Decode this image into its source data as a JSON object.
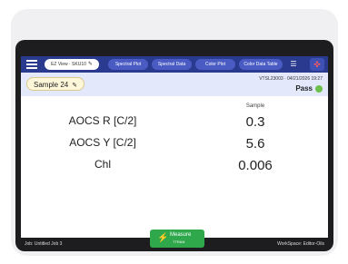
{
  "tabs": {
    "ez_view": "EZ View · SKU10",
    "spectral_plot": "Spectral Plot",
    "spectral_data": "Spectral Data",
    "color_plot": "Color Plot",
    "color_data_table": "Color Data Table"
  },
  "header": {
    "sample_label": "Sample 24",
    "status_line": "VTSL23003 · 04/21/2026 19:27",
    "pass_label": "Pass"
  },
  "table": {
    "column_header": "Sample",
    "rows": [
      {
        "label": "AOCS R [C/2]",
        "value": "0.3"
      },
      {
        "label": "AOCS Y [C/2]",
        "value": "5.6"
      },
      {
        "label": "Chl",
        "value": "0.006"
      }
    ]
  },
  "footer": {
    "job": "Job: Untitled Job 3",
    "workspace": "WorkSpace: Editor-Oils",
    "measure_label": "Measure",
    "measure_mode": "TTRAN"
  },
  "icons": {
    "menu": "hamburger-menu-icon",
    "edit": "pencil-icon",
    "list": "list-add-icon",
    "target": "target-icon",
    "bolt": "lightning-icon"
  },
  "colors": {
    "nav_bar": "#2a3a8f",
    "pass": "#6cc04a",
    "measure": "#2ea84a"
  }
}
